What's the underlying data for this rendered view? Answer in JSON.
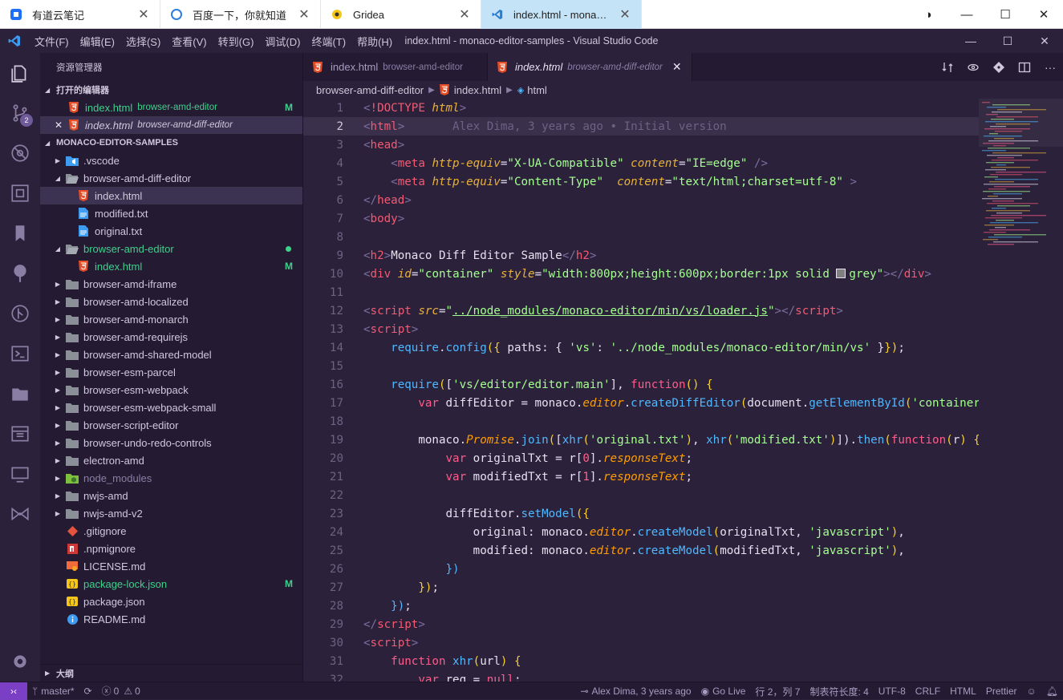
{
  "browser_tabs": [
    {
      "title": "有道云笔记",
      "icon": "note-icon"
    },
    {
      "title": "百度一下，你就知道",
      "icon": "globe-icon"
    },
    {
      "title": "Gridea",
      "icon": "gridea-icon"
    },
    {
      "title": "index.html - mona…",
      "icon": "vscode-icon",
      "active": true
    }
  ],
  "menu": [
    "文件(F)",
    "编辑(E)",
    "选择(S)",
    "查看(V)",
    "转到(G)",
    "调试(D)",
    "终端(T)",
    "帮助(H)"
  ],
  "window_title": "index.html - monaco-editor-samples - Visual Studio Code",
  "activity": {
    "scm_badge": "2"
  },
  "sidebar": {
    "title": "资源管理器",
    "open_editors_label": "打开的编辑器",
    "open_editors": [
      {
        "name": "index.html",
        "desc": "browser-amd-editor",
        "status": "M"
      },
      {
        "name": "index.html",
        "desc": "browser-amd-diff-editor",
        "status": ""
      }
    ],
    "workspace_label": "MONACO-EDITOR-SAMPLES",
    "tree": [
      {
        "name": ".vscode",
        "kind": "folder-vscode",
        "indent": 0,
        "twisty": "closed"
      },
      {
        "name": "browser-amd-diff-editor",
        "kind": "folder-open",
        "indent": 0,
        "twisty": "open"
      },
      {
        "name": "index.html",
        "kind": "html",
        "indent": 1,
        "selected": true
      },
      {
        "name": "modified.txt",
        "kind": "txt",
        "indent": 1
      },
      {
        "name": "original.txt",
        "kind": "txt",
        "indent": 1
      },
      {
        "name": "browser-amd-editor",
        "kind": "folder-open",
        "indent": 0,
        "twisty": "open",
        "color": "green",
        "dot": true
      },
      {
        "name": "index.html",
        "kind": "html",
        "indent": 1,
        "color": "green",
        "status": "M"
      },
      {
        "name": "browser-amd-iframe",
        "kind": "folder",
        "indent": 0,
        "twisty": "closed"
      },
      {
        "name": "browser-amd-localized",
        "kind": "folder",
        "indent": 0,
        "twisty": "closed"
      },
      {
        "name": "browser-amd-monarch",
        "kind": "folder",
        "indent": 0,
        "twisty": "closed"
      },
      {
        "name": "browser-amd-requirejs",
        "kind": "folder",
        "indent": 0,
        "twisty": "closed"
      },
      {
        "name": "browser-amd-shared-model",
        "kind": "folder",
        "indent": 0,
        "twisty": "closed"
      },
      {
        "name": "browser-esm-parcel",
        "kind": "folder",
        "indent": 0,
        "twisty": "closed"
      },
      {
        "name": "browser-esm-webpack",
        "kind": "folder",
        "indent": 0,
        "twisty": "closed"
      },
      {
        "name": "browser-esm-webpack-small",
        "kind": "folder",
        "indent": 0,
        "twisty": "closed"
      },
      {
        "name": "browser-script-editor",
        "kind": "folder",
        "indent": 0,
        "twisty": "closed"
      },
      {
        "name": "browser-undo-redo-controls",
        "kind": "folder",
        "indent": 0,
        "twisty": "closed"
      },
      {
        "name": "electron-amd",
        "kind": "folder",
        "indent": 0,
        "twisty": "closed"
      },
      {
        "name": "node_modules",
        "kind": "folder-node",
        "indent": 0,
        "twisty": "closed",
        "color": "dim"
      },
      {
        "name": "nwjs-amd",
        "kind": "folder",
        "indent": 0,
        "twisty": "closed"
      },
      {
        "name": "nwjs-amd-v2",
        "kind": "folder",
        "indent": 0,
        "twisty": "closed"
      },
      {
        "name": ".gitignore",
        "kind": "git",
        "indent": 0
      },
      {
        "name": ".npmignore",
        "kind": "npm",
        "indent": 0
      },
      {
        "name": "LICENSE.md",
        "kind": "license",
        "indent": 0
      },
      {
        "name": "package-lock.json",
        "kind": "json",
        "indent": 0,
        "color": "green",
        "status": "M"
      },
      {
        "name": "package.json",
        "kind": "json",
        "indent": 0
      },
      {
        "name": "README.md",
        "kind": "info",
        "indent": 0
      }
    ],
    "outline_label": "大纲"
  },
  "editor_tabs": [
    {
      "name": "index.html",
      "desc": "browser-amd-editor",
      "active": false
    },
    {
      "name": "index.html",
      "desc": "browser-amd-diff-editor",
      "active": true
    }
  ],
  "breadcrumb": [
    "browser-amd-diff-editor",
    "index.html",
    "html"
  ],
  "code": [
    {
      "n": "1",
      "t": [
        [
          "t-br",
          "<"
        ],
        [
          "t-tag",
          "!DOCTYPE "
        ],
        [
          "t-attr",
          "html"
        ],
        [
          "t-br",
          ">"
        ]
      ]
    },
    {
      "n": "2",
      "cur": true,
      "t": [
        [
          "t-br",
          "<"
        ],
        [
          "t-tag",
          "html"
        ],
        [
          "t-br",
          ">"
        ],
        [
          "blame",
          "       Alex Dima, 3 years ago • Initial version"
        ]
      ]
    },
    {
      "n": "3",
      "t": [
        [
          "t-br",
          "<"
        ],
        [
          "t-tag",
          "head"
        ],
        [
          "t-br",
          ">"
        ]
      ]
    },
    {
      "n": "4",
      "t": [
        [
          "t-plain",
          "    "
        ],
        [
          "t-br",
          "<"
        ],
        [
          "t-tag",
          "meta "
        ],
        [
          "t-attr",
          "http-equiv"
        ],
        [
          "t-plain",
          "="
        ],
        [
          "t-str",
          "\"X-UA-Compatible\" "
        ],
        [
          "t-attr",
          "content"
        ],
        [
          "t-plain",
          "="
        ],
        [
          "t-str",
          "\"IE=edge\" "
        ],
        [
          "t-br",
          "/>"
        ]
      ]
    },
    {
      "n": "5",
      "t": [
        [
          "t-plain",
          "    "
        ],
        [
          "t-br",
          "<"
        ],
        [
          "t-tag",
          "meta "
        ],
        [
          "t-attr",
          "http-equiv"
        ],
        [
          "t-plain",
          "="
        ],
        [
          "t-str",
          "\"Content-Type\"  "
        ],
        [
          "t-attr",
          "content"
        ],
        [
          "t-plain",
          "="
        ],
        [
          "t-str",
          "\"text/html;charset=utf-8\" "
        ],
        [
          "t-br",
          ">"
        ]
      ]
    },
    {
      "n": "6",
      "t": [
        [
          "t-br",
          "</"
        ],
        [
          "t-tag",
          "head"
        ],
        [
          "t-br",
          ">"
        ]
      ]
    },
    {
      "n": "7",
      "t": [
        [
          "t-br",
          "<"
        ],
        [
          "t-tag",
          "body"
        ],
        [
          "t-br",
          ">"
        ]
      ]
    },
    {
      "n": "8",
      "t": []
    },
    {
      "n": "9",
      "t": [
        [
          "t-br",
          "<"
        ],
        [
          "t-tag",
          "h2"
        ],
        [
          "t-br",
          ">"
        ],
        [
          "t-plain",
          "Monaco Diff Editor Sample"
        ],
        [
          "t-br",
          "</"
        ],
        [
          "t-tag",
          "h2"
        ],
        [
          "t-br",
          ">"
        ]
      ]
    },
    {
      "n": "10",
      "t": [
        [
          "t-br",
          "<"
        ],
        [
          "t-tag",
          "div "
        ],
        [
          "t-attr",
          "id"
        ],
        [
          "t-plain",
          "="
        ],
        [
          "t-str",
          "\"container\" "
        ],
        [
          "t-attr",
          "style"
        ],
        [
          "t-plain",
          "="
        ],
        [
          "t-str",
          "\"width:800px;height:600px;border:1px solid "
        ],
        [
          "swatch",
          " "
        ],
        [
          "t-str",
          "grey\""
        ],
        [
          "t-br",
          "></"
        ],
        [
          "t-tag",
          "div"
        ],
        [
          "t-br",
          ">"
        ]
      ]
    },
    {
      "n": "11",
      "t": []
    },
    {
      "n": "12",
      "t": [
        [
          "t-br",
          "<"
        ],
        [
          "t-tag",
          "script "
        ],
        [
          "t-attr",
          "src"
        ],
        [
          "t-plain",
          "="
        ],
        [
          "t-str",
          "\""
        ],
        [
          "t-link",
          "../node_modules/monaco-editor/min/vs/loader.js"
        ],
        [
          "t-str",
          "\""
        ],
        [
          "t-br",
          "></"
        ],
        [
          "t-tag",
          "script"
        ],
        [
          "t-br",
          ">"
        ]
      ]
    },
    {
      "n": "13",
      "t": [
        [
          "t-br",
          "<"
        ],
        [
          "t-tag",
          "script"
        ],
        [
          "t-br",
          ">"
        ]
      ]
    },
    {
      "n": "14",
      "t": [
        [
          "t-plain",
          "    "
        ],
        [
          "t-fn",
          "require"
        ],
        [
          "t-plain",
          "."
        ],
        [
          "t-fn",
          "config"
        ],
        [
          "t-paren",
          "({"
        ],
        [
          "t-plain",
          " paths: { "
        ],
        [
          "t-str",
          "'vs'"
        ],
        [
          "t-plain",
          ": "
        ],
        [
          "t-str",
          "'../node_modules/monaco-editor/min/vs'"
        ],
        [
          "t-plain",
          " }"
        ],
        [
          "t-paren",
          "})"
        ],
        [
          "t-plain",
          ";"
        ]
      ]
    },
    {
      "n": "15",
      "t": []
    },
    {
      "n": "16",
      "t": [
        [
          "t-plain",
          "    "
        ],
        [
          "t-fn",
          "require"
        ],
        [
          "t-paren",
          "("
        ],
        [
          "t-plain",
          "["
        ],
        [
          "t-str",
          "'vs/editor/editor.main'"
        ],
        [
          "t-plain",
          "], "
        ],
        [
          "t-kw",
          "function"
        ],
        [
          "t-paren",
          "()"
        ],
        [
          "t-plain",
          " "
        ],
        [
          "t-paren",
          "{"
        ]
      ]
    },
    {
      "n": "17",
      "t": [
        [
          "t-plain",
          "        "
        ],
        [
          "t-kw",
          "var "
        ],
        [
          "t-plain",
          "diffEditor = monaco."
        ],
        [
          "t-prop",
          "editor"
        ],
        [
          "t-plain",
          "."
        ],
        [
          "t-fn",
          "createDiffEditor"
        ],
        [
          "t-paren",
          "("
        ],
        [
          "t-plain",
          "document."
        ],
        [
          "t-fn",
          "getElementById"
        ],
        [
          "t-paren",
          "("
        ],
        [
          "t-str",
          "'container"
        ]
      ]
    },
    {
      "n": "18",
      "t": []
    },
    {
      "n": "19",
      "t": [
        [
          "t-plain",
          "        monaco."
        ],
        [
          "t-prop",
          "Promise"
        ],
        [
          "t-plain",
          "."
        ],
        [
          "t-fn",
          "join"
        ],
        [
          "t-paren",
          "("
        ],
        [
          "t-plain",
          "["
        ],
        [
          "t-fn",
          "xhr"
        ],
        [
          "t-paren",
          "("
        ],
        [
          "t-str",
          "'original.txt'"
        ],
        [
          "t-paren",
          ")"
        ],
        [
          "t-plain",
          ", "
        ],
        [
          "t-fn",
          "xhr"
        ],
        [
          "t-paren",
          "("
        ],
        [
          "t-str",
          "'modified.txt'"
        ],
        [
          "t-paren",
          ")"
        ],
        [
          "t-plain",
          "])."
        ],
        [
          "t-fn",
          "then"
        ],
        [
          "t-paren",
          "("
        ],
        [
          "t-kw",
          "function"
        ],
        [
          "t-paren",
          "("
        ],
        [
          "t-plain",
          "r"
        ],
        [
          "t-paren",
          ")"
        ],
        [
          "t-plain",
          " "
        ],
        [
          "t-paren",
          "{"
        ]
      ]
    },
    {
      "n": "20",
      "t": [
        [
          "t-plain",
          "            "
        ],
        [
          "t-kw",
          "var "
        ],
        [
          "t-plain",
          "originalTxt = r["
        ],
        [
          "t-num",
          "0"
        ],
        [
          "t-plain",
          "]."
        ],
        [
          "t-prop",
          "responseText"
        ],
        [
          "t-plain",
          ";"
        ]
      ]
    },
    {
      "n": "21",
      "t": [
        [
          "t-plain",
          "            "
        ],
        [
          "t-kw",
          "var "
        ],
        [
          "t-plain",
          "modifiedTxt = r["
        ],
        [
          "t-num",
          "1"
        ],
        [
          "t-plain",
          "]."
        ],
        [
          "t-prop",
          "responseText"
        ],
        [
          "t-plain",
          ";"
        ]
      ]
    },
    {
      "n": "22",
      "t": []
    },
    {
      "n": "23",
      "t": [
        [
          "t-plain",
          "            diffEditor."
        ],
        [
          "t-fn",
          "setModel"
        ],
        [
          "t-paren",
          "({"
        ]
      ]
    },
    {
      "n": "24",
      "t": [
        [
          "t-plain",
          "                original: monaco."
        ],
        [
          "t-prop",
          "editor"
        ],
        [
          "t-plain",
          "."
        ],
        [
          "t-fn",
          "createModel"
        ],
        [
          "t-paren",
          "("
        ],
        [
          "t-plain",
          "originalTxt, "
        ],
        [
          "t-str",
          "'javascript'"
        ],
        [
          "t-paren",
          ")"
        ],
        [
          "t-plain",
          ","
        ]
      ]
    },
    {
      "n": "25",
      "t": [
        [
          "t-plain",
          "                modified: monaco."
        ],
        [
          "t-prop",
          "editor"
        ],
        [
          "t-plain",
          "."
        ],
        [
          "t-fn",
          "createModel"
        ],
        [
          "t-paren",
          "("
        ],
        [
          "t-plain",
          "modifiedTxt, "
        ],
        [
          "t-str",
          "'javascript'"
        ],
        [
          "t-paren",
          ")"
        ],
        [
          "t-plain",
          ","
        ]
      ]
    },
    {
      "n": "26",
      "t": [
        [
          "t-plain",
          "            "
        ],
        [
          "t-fn",
          "})"
        ]
      ]
    },
    {
      "n": "27",
      "t": [
        [
          "t-plain",
          "        "
        ],
        [
          "t-paren",
          "})"
        ],
        [
          "t-plain",
          ";"
        ]
      ]
    },
    {
      "n": "28",
      "t": [
        [
          "t-plain",
          "    "
        ],
        [
          "t-fn",
          "})"
        ],
        [
          "t-plain",
          ";"
        ]
      ]
    },
    {
      "n": "29",
      "t": [
        [
          "t-br",
          "</"
        ],
        [
          "t-tag",
          "script"
        ],
        [
          "t-br",
          ">"
        ]
      ]
    },
    {
      "n": "30",
      "t": [
        [
          "t-br",
          "<"
        ],
        [
          "t-tag",
          "script"
        ],
        [
          "t-br",
          ">"
        ]
      ]
    },
    {
      "n": "31",
      "t": [
        [
          "t-plain",
          "    "
        ],
        [
          "t-kw",
          "function "
        ],
        [
          "t-fn",
          "xhr"
        ],
        [
          "t-paren",
          "("
        ],
        [
          "t-plain",
          "url"
        ],
        [
          "t-paren",
          ")"
        ],
        [
          "t-plain",
          " "
        ],
        [
          "t-paren",
          "{"
        ]
      ]
    },
    {
      "n": "32",
      "t": [
        [
          "t-plain",
          "        "
        ],
        [
          "t-kw",
          "var "
        ],
        [
          "t-plain",
          "req = "
        ],
        [
          "t-kw",
          "null"
        ],
        [
          "t-plain",
          ";"
        ]
      ]
    }
  ],
  "status": {
    "branch": "master*",
    "errors": "0",
    "warnings": "0",
    "blame": "Alex Dima, 3 years ago",
    "golive": "Go Live",
    "position": "行 2，列 7",
    "tabsize": "制表符长度: 4",
    "encoding": "UTF-8",
    "eol": "CRLF",
    "language": "HTML",
    "formatter": "Prettier"
  }
}
